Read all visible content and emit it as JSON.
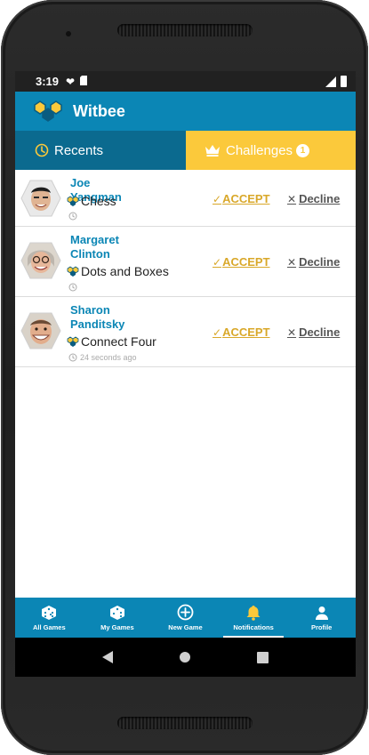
{
  "statusbar": {
    "time": "3:19"
  },
  "app": {
    "title": "Witbee",
    "brand_color": "#0b86b5",
    "accent_color": "#fbc93b"
  },
  "tabs": [
    {
      "label": "Recents",
      "icon": "clock-icon"
    },
    {
      "label": "Challenges",
      "icon": "crown-icon",
      "badge": "1"
    }
  ],
  "challenges": [
    {
      "name": "Joe Yangman",
      "game": "Chess",
      "time": "",
      "accept": "ACCEPT",
      "decline": "Decline"
    },
    {
      "name": "Margaret Clinton",
      "game": "Dots and Boxes",
      "time": "",
      "accept": "ACCEPT",
      "decline": "Decline"
    },
    {
      "name": "Sharon Panditsky",
      "game": "Connect Four",
      "time": "24 seconds ago",
      "accept": "ACCEPT",
      "decline": "Decline"
    }
  ],
  "bottom_nav": [
    {
      "label": "All Games",
      "icon": "dice-icon"
    },
    {
      "label": "My Games",
      "icon": "dice-icon"
    },
    {
      "label": "New Game",
      "icon": "plus-circle-icon"
    },
    {
      "label": "Notifications",
      "icon": "bell-icon",
      "active": true
    },
    {
      "label": "Profile",
      "icon": "person-icon"
    }
  ]
}
